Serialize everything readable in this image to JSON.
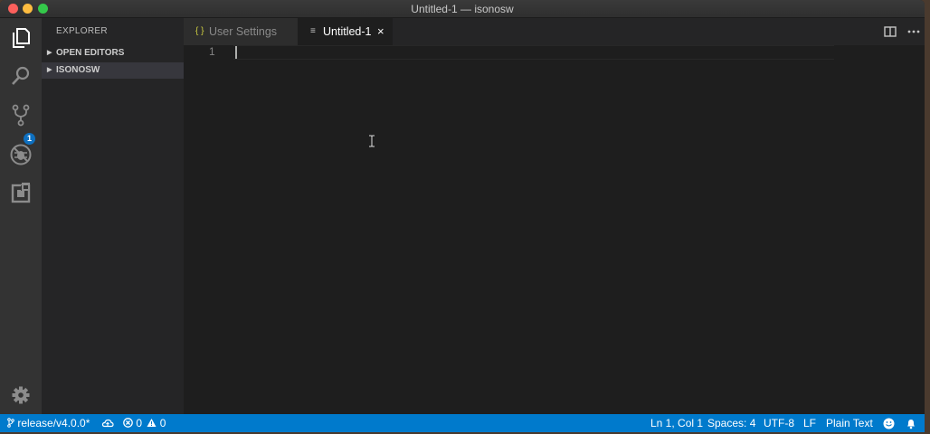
{
  "window": {
    "title": "Untitled-1 — isonosw"
  },
  "activity_bar": {
    "items": [
      {
        "name": "explorer",
        "icon": "files-icon"
      },
      {
        "name": "search",
        "icon": "search-icon"
      },
      {
        "name": "source-control",
        "icon": "git-branch-icon",
        "badge": "1"
      },
      {
        "name": "debug",
        "icon": "bug-icon"
      },
      {
        "name": "extensions",
        "icon": "extensions-icon"
      }
    ],
    "settings_icon": "gear-icon"
  },
  "sidebar": {
    "title": "EXPLORER",
    "sections": [
      {
        "label": "OPEN EDITORS"
      },
      {
        "label": "ISONOSW"
      }
    ]
  },
  "tabs": [
    {
      "icon_text": "{ }",
      "label": "User Settings",
      "active": false
    },
    {
      "icon_text": "≡",
      "label": "Untitled-1",
      "active": true,
      "close": "×"
    }
  ],
  "editor": {
    "line_numbers": [
      "1"
    ]
  },
  "status_bar": {
    "branch": "release/v4.0.0*",
    "errors": "0",
    "warnings": "0",
    "position": "Ln 1, Col 1",
    "spaces": "Spaces: 4",
    "encoding": "UTF-8",
    "eol": "LF",
    "language": "Plain Text"
  },
  "colors": {
    "activity_bar": "#333333",
    "sidebar": "#252526",
    "editor": "#1e1e1e",
    "status_bar": "#007acc",
    "badge": "#0e70c0"
  }
}
